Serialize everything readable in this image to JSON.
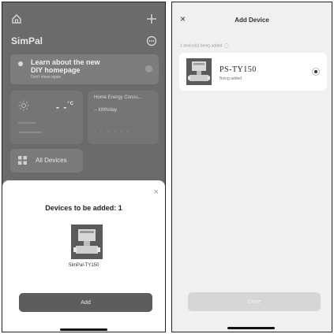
{
  "left": {
    "app_title": "SimPal",
    "banner": {
      "line1": "Learn about the new",
      "line2": "DIY homepage",
      "line3": "Don't show again"
    },
    "weather": {
      "temp": "- -",
      "unit": "°C"
    },
    "energy": {
      "title": "Home Energy Consu...",
      "value": "-- kWh/day",
      "dashes": "- - - - - -"
    },
    "all_devices_label": "All Devices",
    "sheet": {
      "close": "×",
      "title": "Devices to be added: 1",
      "device_name": "SimPal-TY150",
      "add_label": "Add"
    }
  },
  "right": {
    "close": "×",
    "title": "Add Device",
    "progress_text": "1 device(s) being added",
    "device": {
      "name": "PS-TY150",
      "status": "Being added"
    },
    "done_label": "Done"
  },
  "colors": {
    "overlay": "#6b6b6b",
    "sheet": "#ffffff",
    "add_button": "#5d5d5d",
    "done_button_disabled": "#d6d6d6"
  }
}
